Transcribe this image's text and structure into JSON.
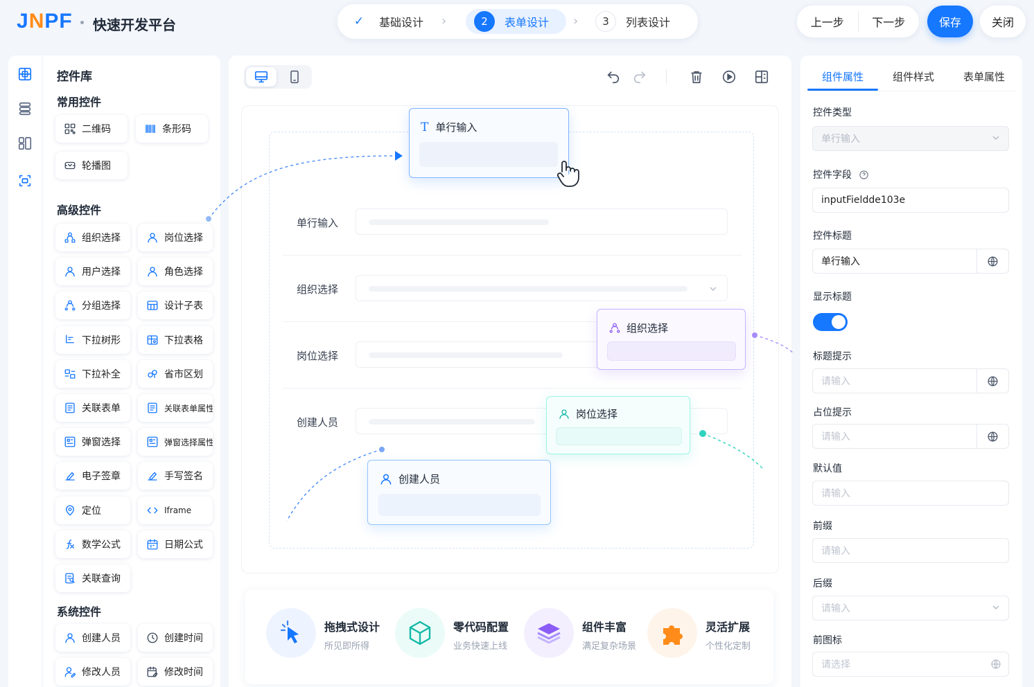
{
  "brand": {
    "logo_a": "J",
    "logo_b": "N",
    "logo_c": "P",
    "logo_d": "F",
    "title": "快速开发平台"
  },
  "steps": [
    {
      "num": "✓",
      "label": "基础设计"
    },
    {
      "num": "2",
      "label": "表单设计"
    },
    {
      "num": "3",
      "label": "列表设计"
    }
  ],
  "actions": {
    "prev": "上一步",
    "next": "下一步",
    "save": "保存",
    "close": "关闭"
  },
  "library": {
    "title": "控件库",
    "common_title": "常用控件",
    "common": [
      {
        "label": "二维码",
        "icon": "qrcode-icon"
      },
      {
        "label": "条形码",
        "icon": "barcode-icon"
      },
      {
        "label": "轮播图",
        "icon": "carousel-icon"
      }
    ],
    "advanced_title": "高级控件",
    "advanced": [
      {
        "label": "组织选择",
        "icon": "org-icon"
      },
      {
        "label": "岗位选择",
        "icon": "post-icon"
      },
      {
        "label": "用户选择",
        "icon": "user-icon"
      },
      {
        "label": "角色选择",
        "icon": "role-icon"
      },
      {
        "label": "分组选择",
        "icon": "group-icon"
      },
      {
        "label": "设计子表",
        "icon": "subtable-icon"
      },
      {
        "label": "下拉树形",
        "icon": "tree-icon"
      },
      {
        "label": "下拉表格",
        "icon": "table-icon"
      },
      {
        "label": "下拉补全",
        "icon": "autocomplete-icon"
      },
      {
        "label": "省市区划",
        "icon": "region-icon"
      },
      {
        "label": "关联表单",
        "icon": "link-form-icon"
      },
      {
        "label": "关联表单属性",
        "icon": "link-attr-icon"
      },
      {
        "label": "弹窗选择",
        "icon": "popup-icon"
      },
      {
        "label": "弹窗选择属性",
        "icon": "popup-attr-icon"
      },
      {
        "label": "电子签章",
        "icon": "seal-icon"
      },
      {
        "label": "手写签名",
        "icon": "sign-icon"
      },
      {
        "label": "定位",
        "icon": "location-icon"
      },
      {
        "label": "Iframe",
        "icon": "code-icon"
      },
      {
        "label": "数学公式",
        "icon": "formula-icon"
      },
      {
        "label": "日期公式",
        "icon": "calendar-icon"
      },
      {
        "label": "关联查询",
        "icon": "query-icon"
      }
    ],
    "system_title": "系统控件",
    "system": [
      {
        "label": "创建人员",
        "icon": "user-icon"
      },
      {
        "label": "创建时间",
        "icon": "clock-icon"
      },
      {
        "label": "修改人员",
        "icon": "user-edit-icon"
      },
      {
        "label": "修改时间",
        "icon": "calendar-edit-icon"
      }
    ]
  },
  "canvas": {
    "rows": [
      {
        "label": "单行输入"
      },
      {
        "label": "组织选择"
      },
      {
        "label": "岗位选择"
      },
      {
        "label": "创建人员"
      }
    ],
    "drag_cards": {
      "single_input": "单行输入",
      "org_select": "组织选择",
      "post_select": "岗位选择",
      "creator": "创建人员"
    },
    "features": [
      {
        "title": "拖拽式设计",
        "sub": "所见即所得"
      },
      {
        "title": "零代码配置",
        "sub": "业务快速上线"
      },
      {
        "title": "组件丰富",
        "sub": "满足复杂场景"
      },
      {
        "title": "灵活扩展",
        "sub": "个性化定制"
      }
    ]
  },
  "props": {
    "tabs": [
      "组件属性",
      "组件样式",
      "表单属性"
    ],
    "type_label": "控件类型",
    "type_value": "单行输入",
    "field_label": "控件字段",
    "field_value": "inputFieldde103e",
    "title_label": "控件标题",
    "title_value": "单行输入",
    "show_title_label": "显示标题",
    "show_title": true,
    "tip_label": "标题提示",
    "tip_ph": "请输入",
    "placeholder_label": "占位提示",
    "placeholder_ph": "请输入",
    "default_label": "默认值",
    "default_ph": "请输入",
    "prefix_label": "前缀",
    "prefix_ph": "请输入",
    "suffix_label": "后缀",
    "suffix_ph": "请输入",
    "icon_label": "前图标",
    "icon_ph": "请选择"
  },
  "colors": {
    "primary": "#1677ff",
    "purple": "#8b5cf6",
    "teal": "#2dd4bf",
    "orange": "#ff8c1a"
  }
}
